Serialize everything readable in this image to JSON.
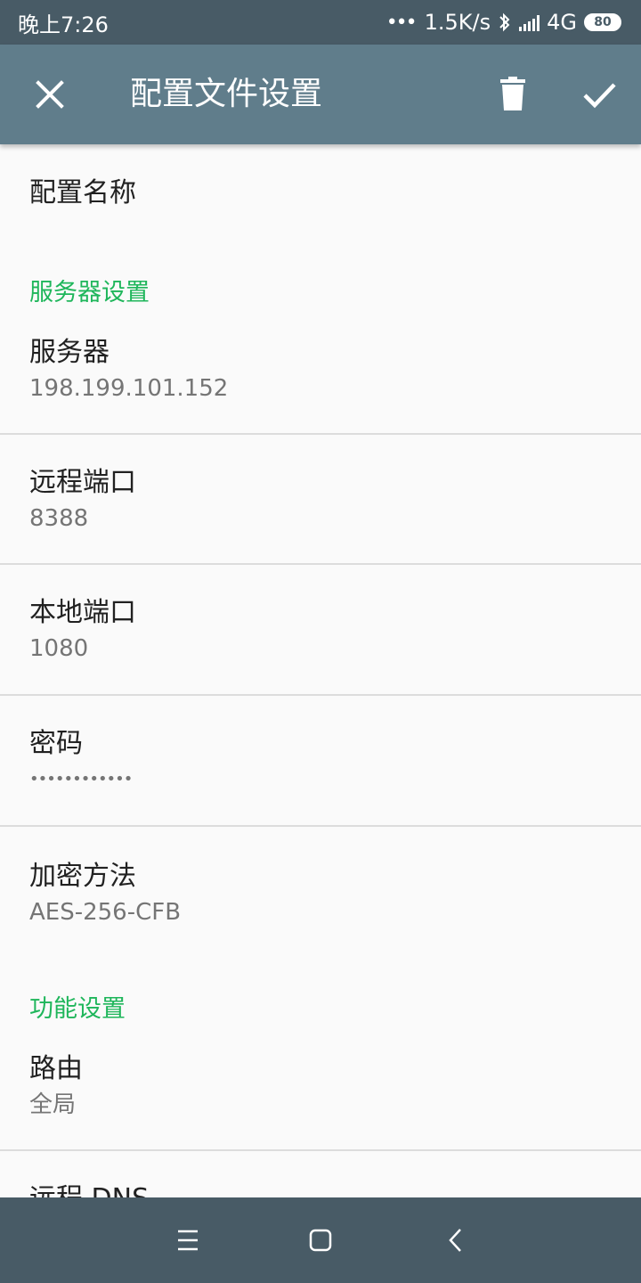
{
  "status_bar": {
    "time": "晚上7:26",
    "speed": "1.5K/s",
    "network": "4G",
    "battery": "80",
    "icons": [
      "dots-icon",
      "bluetooth-icon",
      "signal-icon",
      "battery-icon"
    ]
  },
  "toolbar": {
    "title": "配置文件设置",
    "close_icon": "close-icon",
    "delete_icon": "trash-icon",
    "save_icon": "check-icon"
  },
  "prefs": {
    "profile_name": {
      "title": "配置名称"
    },
    "server_category": "服务器设置",
    "server": {
      "title": "服务器",
      "value": "198.199.101.152"
    },
    "remote_port": {
      "title": "远程端口",
      "value": "8388"
    },
    "local_port": {
      "title": "本地端口",
      "value": "1080"
    },
    "password": {
      "title": "密码",
      "value": "••••••••••••"
    },
    "method": {
      "title": "加密方法",
      "value": "AES-256-CFB"
    },
    "feature_category": "功能设置",
    "route": {
      "title": "路由",
      "value": "全局"
    },
    "remote_dns": {
      "title": "远程 DNS"
    }
  },
  "nav": {
    "icons": [
      "menu-icon",
      "home-icon",
      "back-icon"
    ]
  }
}
